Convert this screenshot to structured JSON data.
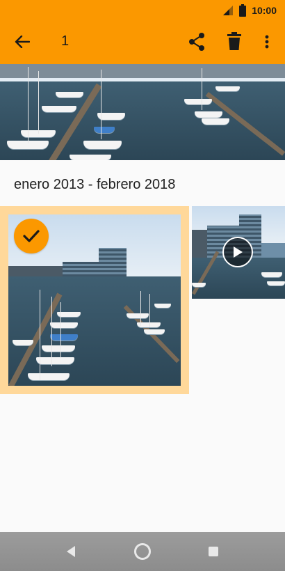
{
  "status_bar": {
    "time": "10:00",
    "signal_icon": "cell-signal-icon",
    "battery_icon": "battery-icon"
  },
  "toolbar": {
    "selected_count": "1",
    "back_icon": "arrow-back-icon",
    "share_icon": "share-icon",
    "delete_icon": "trash-icon",
    "more_icon": "more-vert-icon"
  },
  "section": {
    "title": "enero 2013 - febrero 2018"
  },
  "grid": {
    "items": [
      {
        "type": "photo",
        "selected": true,
        "badge_icon": "check-icon"
      },
      {
        "type": "video",
        "selected": false,
        "overlay_icon": "play-icon"
      }
    ]
  },
  "navigation_bar": {
    "back_icon": "nav-back-icon",
    "home_icon": "nav-home-icon",
    "recent_icon": "nav-recent-icon"
  },
  "colors": {
    "accent": "#fb9800",
    "selection_border": "#ffd89a",
    "nav_bar": "#919191"
  }
}
